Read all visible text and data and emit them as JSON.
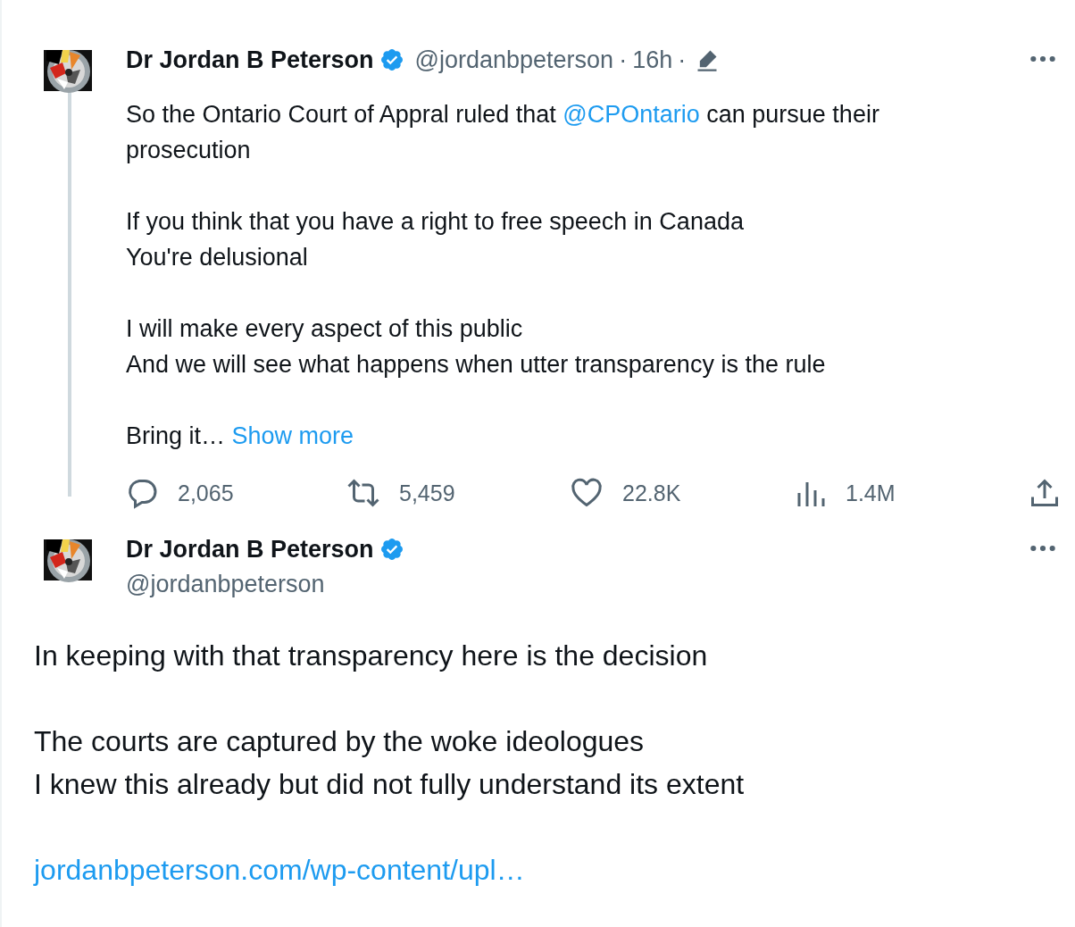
{
  "tweets": [
    {
      "kind": "thread",
      "name": "Dr Jordan B Peterson",
      "verified": true,
      "handle": "@jordanbpeterson",
      "separator": "·",
      "time": "16h",
      "edited": true,
      "paragraphs": [
        [
          [
            {
              "kind": "text",
              "text": "So the Ontario Court of Appral ruled that "
            },
            {
              "kind": "mention",
              "text": "@CPOntario"
            },
            {
              "kind": "text",
              "text": " can pursue their"
            }
          ],
          [
            {
              "kind": "text",
              "text": "prosecution"
            }
          ]
        ],
        [
          [
            {
              "kind": "text",
              "text": "If you think that you have a right to free speech in Canada"
            }
          ],
          [
            {
              "kind": "text",
              "text": "You're delusional"
            }
          ]
        ],
        [
          [
            {
              "kind": "text",
              "text": "I will make every aspect of this public"
            }
          ],
          [
            {
              "kind": "text",
              "text": "And we will see what happens when utter transparency is the rule"
            }
          ]
        ],
        [
          [
            {
              "kind": "text",
              "text": "Bring it… "
            },
            {
              "kind": "more",
              "text": "Show more"
            }
          ]
        ]
      ],
      "actions": [
        {
          "kind": "reply",
          "count": "2,065"
        },
        {
          "kind": "retweet",
          "count": "5,459"
        },
        {
          "kind": "like",
          "count": "22.8K"
        },
        {
          "kind": "views",
          "count": "1.4M"
        },
        {
          "kind": "share"
        }
      ]
    },
    {
      "kind": "main",
      "name": "Dr Jordan B Peterson",
      "verified": true,
      "handle": "@jordanbpeterson",
      "paragraphs": [
        [
          [
            {
              "kind": "text",
              "text": "In keeping with that transparency here is the decision"
            }
          ]
        ],
        [
          [
            {
              "kind": "text",
              "text": "The courts are captured by the woke ideologues"
            }
          ],
          [
            {
              "kind": "text",
              "text": "I knew this already but did not fully understand its extent"
            }
          ]
        ],
        [
          [
            {
              "kind": "link",
              "text": "jordanbpeterson.com/wp-content/upl…"
            }
          ]
        ]
      ]
    }
  ]
}
